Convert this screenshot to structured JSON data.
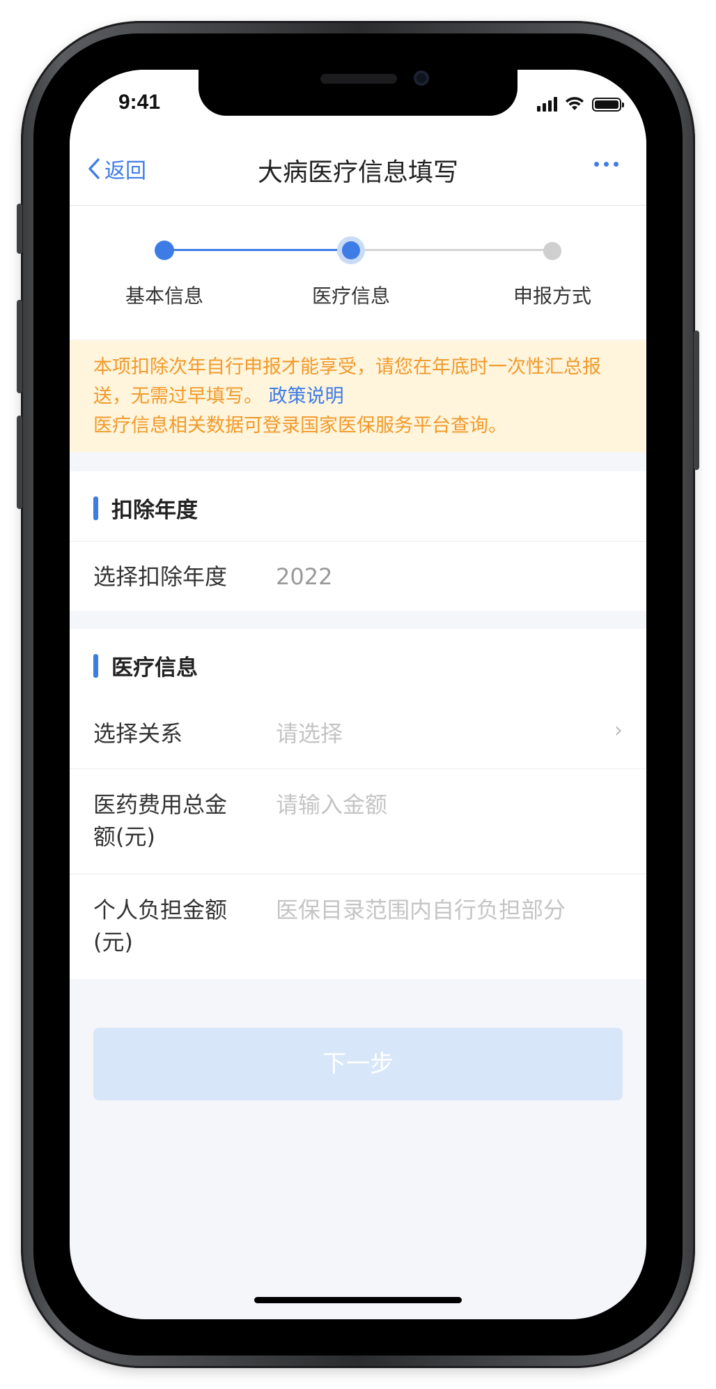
{
  "status_bar": {
    "time": "9:41"
  },
  "nav": {
    "back_label": "返回",
    "title": "大病医疗信息填写"
  },
  "stepper": {
    "steps": [
      {
        "label": "基本信息",
        "state": "done"
      },
      {
        "label": "医疗信息",
        "state": "current"
      },
      {
        "label": "申报方式",
        "state": "pending"
      }
    ]
  },
  "notice": {
    "line1": "本项扣除次年自行申报才能享受，请您在年底时一次性汇总报送，无需过早填写。",
    "link": "政策说明",
    "line2": "医疗信息相关数据可登录国家医保服务平台查询。"
  },
  "deduction_section": {
    "title": "扣除年度",
    "row_label": "选择扣除年度",
    "row_value": "2022"
  },
  "medical_section": {
    "title": "医疗信息",
    "relation": {
      "label": "选择关系",
      "placeholder": "请选择"
    },
    "total_amount": {
      "label": "医药费用总金额(元)",
      "placeholder": "请输入金额"
    },
    "personal_amount": {
      "label": "个人负担金额(元)",
      "placeholder": "医保目录范围内自行负担部分"
    }
  },
  "next_button": {
    "label": "下一步"
  },
  "colors": {
    "accent": "#3d7ce6",
    "notice_bg": "#fff4dc",
    "notice_text": "#f19a2a",
    "button_disabled": "#d8e6fa"
  },
  "icons": [
    "back-chevron-icon",
    "more-icon",
    "signal-icon",
    "wifi-icon",
    "battery-icon",
    "chevron-right-icon"
  ]
}
